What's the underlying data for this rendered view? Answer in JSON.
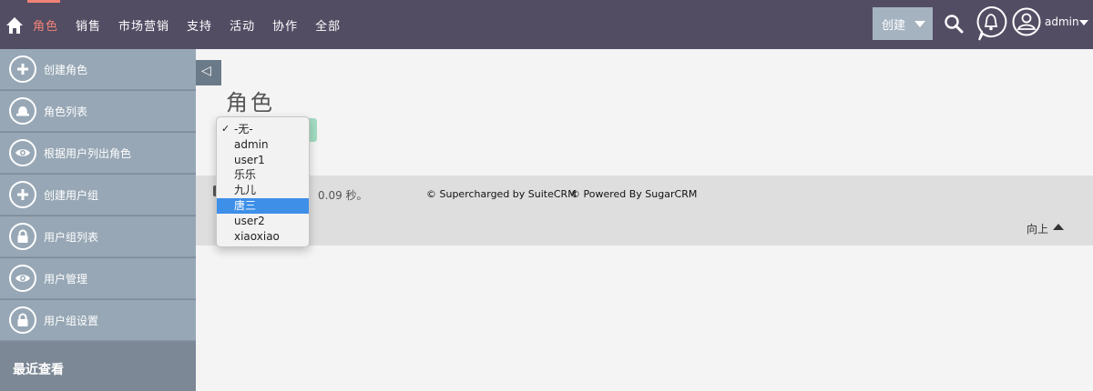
{
  "nav": {
    "items": [
      {
        "label": "角色",
        "active": true
      },
      {
        "label": "销售"
      },
      {
        "label": "市场营销"
      },
      {
        "label": "支持"
      },
      {
        "label": "活动"
      },
      {
        "label": "协作"
      },
      {
        "label": "全部"
      }
    ],
    "accent_color": "#f08377"
  },
  "header": {
    "create_label": "创建",
    "user_name": "admin"
  },
  "sidebar": {
    "items": [
      {
        "label": "创建角色",
        "icon": "plus-icon"
      },
      {
        "label": "角色列表",
        "icon": "hat-icon"
      },
      {
        "label": "根据用户列出角色",
        "icon": "eye-icon"
      },
      {
        "label": "创建用户组",
        "icon": "plus-icon"
      },
      {
        "label": "用户组列表",
        "icon": "lock-icon"
      },
      {
        "label": "用户管理",
        "icon": "eye-icon"
      },
      {
        "label": "用户组设置",
        "icon": "lock-icon"
      }
    ],
    "recent_label": "最近查看",
    "collapse_glyph": "◁"
  },
  "main": {
    "title": "角色"
  },
  "dropdown": {
    "options": [
      "-无-",
      "admin",
      "user1",
      "乐乐",
      "九儿",
      "唐三",
      "user2",
      "xiaoxiao"
    ],
    "checked_index": 0,
    "highlighted_index": 5,
    "checkmark": "✓"
  },
  "footer": {
    "time_text": "0.09 秒。",
    "supercharged": "© Supercharged by SuiteCRM",
    "powered": "© Powered By SugarCRM",
    "back_to_top": "向上"
  }
}
